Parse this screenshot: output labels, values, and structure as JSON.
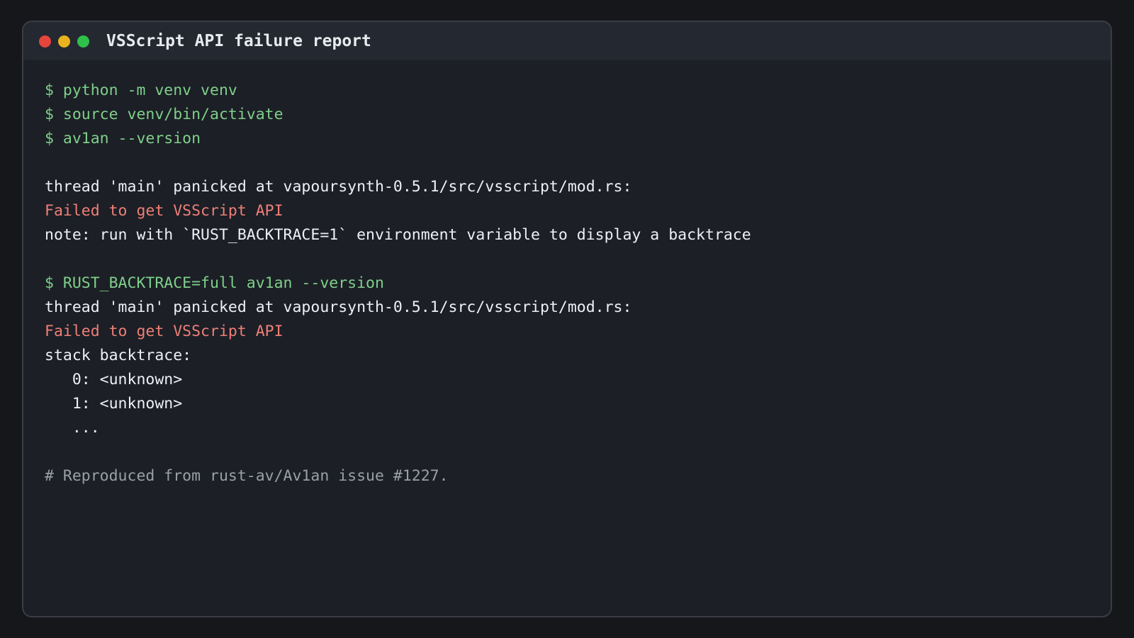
{
  "window": {
    "title": "VSScript API failure report",
    "controls": [
      "close-dot",
      "minimize-dot",
      "maximize-dot"
    ]
  },
  "terminal": {
    "lines": [
      {
        "kind": "cmd",
        "text": "$ python -m venv venv"
      },
      {
        "kind": "cmd",
        "text": "$ source venv/bin/activate"
      },
      {
        "kind": "cmd",
        "text": "$ av1an --version"
      },
      {
        "kind": "blank",
        "text": ""
      },
      {
        "kind": "out",
        "text": "thread 'main' panicked at vapoursynth-0.5.1/src/vsscript/mod.rs:"
      },
      {
        "kind": "err",
        "text": "Failed to get VSScript API"
      },
      {
        "kind": "out",
        "text": "note: run with `RUST_BACKTRACE=1` environment variable to display a backtrace"
      },
      {
        "kind": "blank",
        "text": ""
      },
      {
        "kind": "cmd",
        "text": "$ RUST_BACKTRACE=full av1an --version"
      },
      {
        "kind": "out",
        "text": "thread 'main' panicked at vapoursynth-0.5.1/src/vsscript/mod.rs:"
      },
      {
        "kind": "err",
        "text": "Failed to get VSScript API"
      },
      {
        "kind": "out",
        "text": "stack backtrace:"
      },
      {
        "kind": "out",
        "text": "   0: <unknown>"
      },
      {
        "kind": "out",
        "text": "   1: <unknown>"
      },
      {
        "kind": "out",
        "text": "   ..."
      },
      {
        "kind": "blank",
        "text": ""
      },
      {
        "kind": "comment",
        "text": "# Reproduced from rust-av/Av1an issue #1227."
      }
    ]
  },
  "colors": {
    "background": "#15171b",
    "window": "#1c1f26",
    "titlebar": "#242831",
    "command": "#7fcf8a",
    "error": "#ef7f77",
    "output": "#eef0f3",
    "comment": "#9a9fa8"
  }
}
